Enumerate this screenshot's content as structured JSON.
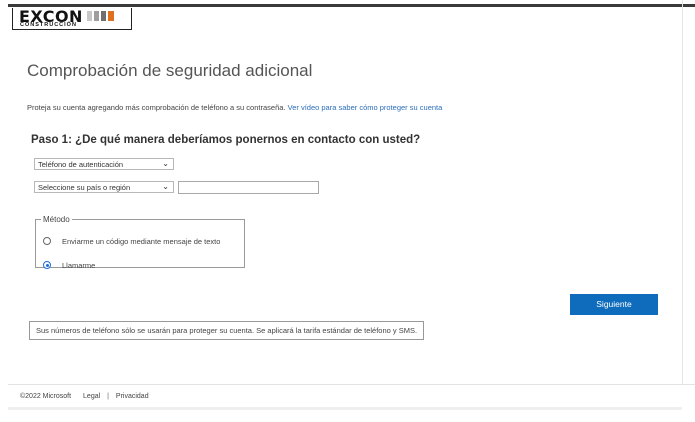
{
  "brand": {
    "name": "EXCON",
    "subtitle": "CONSTRUCCIÓN",
    "bar_colors": [
      "#c8c8c8",
      "#9e9e9e",
      "#6f6f6f",
      "#e07020"
    ]
  },
  "page": {
    "title": "Comprobación de seguridad adicional",
    "intro_text": "Proteja su cuenta agregando más comprobación de teléfono a su contraseña.",
    "intro_link": "Ver vídeo para saber cómo proteger su cuenta",
    "step_title": "Paso 1: ¿De qué manera deberíamos ponernos en contacto con usted?"
  },
  "form": {
    "contact_method": {
      "value": "Teléfono de autenticación"
    },
    "country": {
      "value": "Seleccione su país o región"
    },
    "phone_number": {
      "value": ""
    },
    "method": {
      "legend": "Método",
      "options": [
        {
          "label": "Enviarme un código mediante mensaje de texto",
          "checked": false
        },
        {
          "label": "Llamarme",
          "checked": true
        }
      ]
    },
    "next_button": "Siguiente",
    "notice": "Sus números de teléfono sólo se usarán para proteger su cuenta. Se aplicará la tarifa estándar de teléfono y SMS."
  },
  "footer": {
    "copyright": "©2022 Microsoft",
    "legal": "Legal",
    "separator": "|",
    "privacy": "Privacidad"
  },
  "colors": {
    "accent": "#0f6cbd",
    "link": "#2a6ebb",
    "radio_selected": "#1f6fd6"
  },
  "icons": {
    "dropdown": "chevron-down-icon"
  }
}
